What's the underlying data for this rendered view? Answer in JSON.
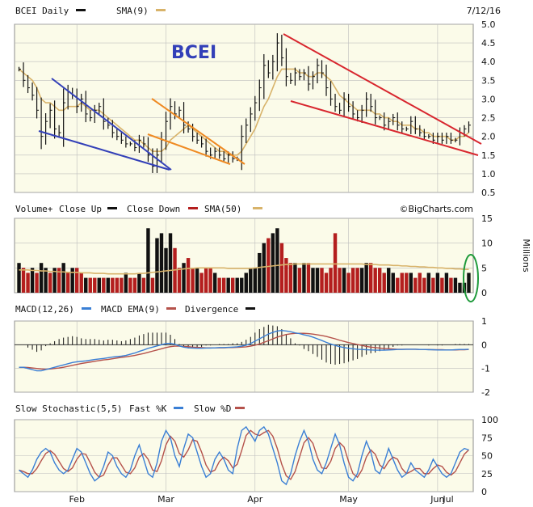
{
  "header": {
    "symbol_label": "BCEI Daily",
    "sma_label": "SMA(9)",
    "date": "7/12/16"
  },
  "annotation_ticker": "BCEI",
  "volume_header": {
    "title": "Volume+",
    "close_up": "Close Up",
    "close_down": "Close Down",
    "sma": "SMA(50)",
    "source": "©BigCharts.com",
    "units": "Millions"
  },
  "macd_header": {
    "title": "MACD(12,26)",
    "ema": "MACD EMA(9)",
    "divergence": "Divergence"
  },
  "stoch_header": {
    "title": "Slow Stochastic(5,5)",
    "fast": "Fast %K",
    "slow": "Slow %D"
  },
  "colors": {
    "panel_bg": "#fbfbe9",
    "grid": "#bdbdbd",
    "up": "#111111",
    "down": "#b41e1e",
    "sma": "#d8b36a",
    "macd": "#3a7fd5",
    "macd_ema": "#b5524b",
    "fast_k": "#3a7fd5",
    "slow_d": "#b5524b",
    "blue_trend": "#3340b8",
    "orange_trend": "#ef8a22",
    "red_trend": "#d8262e",
    "highlight_ellipse": "#1e9a3a"
  },
  "chart_data": [
    {
      "type": "line",
      "name": "price",
      "title": "BCEI Daily",
      "x_ticks": [
        "Feb",
        "Mar",
        "Apr",
        "May",
        "Jun",
        "Jul"
      ],
      "y_ticks": [
        "0.5",
        "1.0",
        "1.5",
        "2.0",
        "2.5",
        "3.0",
        "3.5",
        "4.0",
        "4.5",
        "5.0"
      ],
      "ylim": [
        0.5,
        5.0
      ],
      "close": [
        3.8,
        3.5,
        3.3,
        3.1,
        2.7,
        2.0,
        2.4,
        2.7,
        2.2,
        2.1,
        2.9,
        3.2,
        3.1,
        2.8,
        3.0,
        2.6,
        2.5,
        2.7,
        2.8,
        2.4,
        2.3,
        2.1,
        2.0,
        1.9,
        1.8,
        1.8,
        1.7,
        1.9,
        1.8,
        1.5,
        1.2,
        1.5,
        1.9,
        2.4,
        2.8,
        2.6,
        2.7,
        2.3,
        2.2,
        2.0,
        1.9,
        1.8,
        1.6,
        1.5,
        1.6,
        1.5,
        1.4,
        1.5,
        1.4,
        1.4,
        2.0,
        2.3,
        2.6,
        2.9,
        3.3,
        3.9,
        3.7,
        4.0,
        4.5,
        4.1,
        3.6,
        3.5,
        3.7,
        3.6,
        3.7,
        3.4,
        3.6,
        3.9,
        3.7,
        3.3,
        3.0,
        2.8,
        2.7,
        3.0,
        2.8,
        2.6,
        2.5,
        2.7,
        3.0,
        2.8,
        2.5,
        2.5,
        2.3,
        2.4,
        2.5,
        2.3,
        2.2,
        2.2,
        2.4,
        2.2,
        2.1,
        2.0,
        2.0,
        1.9,
        2.0,
        1.9,
        2.0,
        1.9,
        1.9,
        2.1,
        2.2,
        2.3
      ],
      "sma9": [
        3.8,
        3.7,
        3.6,
        3.5,
        3.3,
        3.0,
        2.9,
        2.9,
        2.8,
        2.7,
        2.7,
        2.8,
        2.8,
        2.8,
        2.9,
        2.8,
        2.7,
        2.7,
        2.7,
        2.6,
        2.5,
        2.4,
        2.3,
        2.2,
        2.1,
        2.0,
        1.9,
        1.9,
        1.8,
        1.7,
        1.6,
        1.6,
        1.6,
        1.7,
        1.9,
        2.0,
        2.1,
        2.2,
        2.3,
        2.2,
        2.1,
        2.0,
        1.9,
        1.8,
        1.7,
        1.6,
        1.6,
        1.5,
        1.5,
        1.5,
        1.6,
        1.8,
        2.0,
        2.2,
        2.5,
        2.8,
        3.0,
        3.3,
        3.6,
        3.8,
        3.8,
        3.8,
        3.8,
        3.7,
        3.7,
        3.6,
        3.6,
        3.7,
        3.7,
        3.6,
        3.5,
        3.3,
        3.1,
        3.0,
        2.9,
        2.8,
        2.7,
        2.7,
        2.7,
        2.7,
        2.6,
        2.6,
        2.5,
        2.5,
        2.4,
        2.4,
        2.3,
        2.3,
        2.3,
        2.2,
        2.2,
        2.1,
        2.1,
        2.0,
        2.0,
        2.0,
        2.0,
        1.9,
        1.9,
        2.0,
        2.0,
        2.1
      ]
    },
    {
      "type": "bar",
      "name": "volume",
      "y_ticks": [
        "0",
        "5",
        "10",
        "15"
      ],
      "ylim": [
        0,
        15
      ],
      "values": [
        6,
        5,
        4,
        5,
        4,
        6,
        5,
        4,
        5,
        5,
        6,
        4,
        5,
        5,
        4,
        3,
        3,
        3,
        3,
        3,
        3,
        3,
        3,
        3,
        4,
        3,
        3,
        4,
        3,
        13,
        3,
        11,
        12,
        9,
        12,
        9,
        5,
        6,
        7,
        5,
        5,
        4,
        5,
        5,
        4,
        3,
        3,
        3,
        3,
        3,
        3,
        4,
        5,
        5,
        8,
        10,
        11,
        12,
        13,
        10,
        7,
        6,
        6,
        5,
        6,
        6,
        5,
        5,
        5,
        4,
        5,
        12,
        5,
        5,
        4,
        5,
        5,
        5,
        6,
        6,
        5,
        5,
        4,
        5,
        4,
        3,
        4,
        4,
        4,
        3,
        4,
        3,
        4,
        3,
        4,
        3,
        4,
        3,
        3,
        2,
        2,
        4
      ],
      "up": [
        1,
        0,
        0,
        1,
        0,
        1,
        1,
        0,
        1,
        0,
        1,
        0,
        1,
        0,
        0,
        1,
        0,
        0,
        1,
        0,
        1,
        0,
        0,
        0,
        1,
        0,
        0,
        1,
        0,
        1,
        0,
        1,
        1,
        1,
        1,
        0,
        0,
        1,
        0,
        0,
        1,
        0,
        0,
        0,
        1,
        0,
        0,
        1,
        0,
        1,
        1,
        1,
        1,
        1,
        1,
        1,
        0,
        1,
        1,
        0,
        0,
        0,
        1,
        0,
        1,
        0,
        1,
        1,
        0,
        0,
        0,
        0,
        0,
        1,
        0,
        0,
        0,
        1,
        1,
        0,
        0,
        0,
        0,
        1,
        1,
        0,
        0,
        0,
        1,
        0,
        0,
        0,
        1,
        0,
        1,
        0,
        1,
        0,
        1,
        1,
        1,
        1
      ],
      "sma50": [
        4.6,
        4.6,
        4.6,
        4.5,
        4.5,
        4.4,
        4.4,
        4.3,
        4.3,
        4.2,
        4.2,
        4.1,
        4.1,
        4.1,
        4.0,
        4.0,
        4.0,
        3.9,
        3.9,
        3.9,
        3.8,
        3.8,
        3.8,
        3.8,
        3.8,
        3.8,
        3.8,
        3.9,
        3.9,
        4.0,
        4.1,
        4.2,
        4.3,
        4.4,
        4.5,
        4.6,
        4.7,
        4.8,
        4.9,
        4.9,
        5.0,
        5.0,
        5.0,
        5.0,
        5.0,
        5.0,
        5.0,
        4.9,
        4.9,
        4.9,
        4.9,
        4.9,
        4.9,
        5.0,
        5.1,
        5.2,
        5.3,
        5.4,
        5.5,
        5.6,
        5.7,
        5.7,
        5.8,
        5.8,
        5.8,
        5.8,
        5.8,
        5.8,
        5.8,
        5.8,
        5.8,
        5.8,
        5.8,
        5.8,
        5.8,
        5.8,
        5.8,
        5.8,
        5.7,
        5.7,
        5.7,
        5.6,
        5.6,
        5.6,
        5.5,
        5.5,
        5.4,
        5.4,
        5.3,
        5.3,
        5.2,
        5.2,
        5.1,
        5.1,
        5.0,
        5.0,
        4.9,
        4.9,
        4.8,
        4.8,
        4.7,
        4.7
      ]
    },
    {
      "type": "line",
      "name": "macd",
      "y_ticks": [
        "1",
        "0",
        "-1",
        "-2"
      ],
      "ylim": [
        -2,
        1
      ],
      "macd": [
        -0.95,
        -0.95,
        -1.0,
        -1.05,
        -1.1,
        -1.1,
        -1.05,
        -1.0,
        -0.95,
        -0.9,
        -0.85,
        -0.8,
        -0.75,
        -0.72,
        -0.7,
        -0.68,
        -0.65,
        -0.62,
        -0.6,
        -0.58,
        -0.55,
        -0.52,
        -0.5,
        -0.48,
        -0.45,
        -0.4,
        -0.35,
        -0.28,
        -0.22,
        -0.15,
        -0.1,
        -0.05,
        0.0,
        0.05,
        0.06,
        0.02,
        -0.05,
        -0.1,
        -0.13,
        -0.14,
        -0.15,
        -0.15,
        -0.14,
        -0.14,
        -0.13,
        -0.12,
        -0.12,
        -0.11,
        -0.1,
        -0.09,
        -0.06,
        -0.02,
        0.05,
        0.15,
        0.25,
        0.35,
        0.45,
        0.52,
        0.58,
        0.6,
        0.58,
        0.55,
        0.5,
        0.47,
        0.42,
        0.38,
        0.32,
        0.25,
        0.18,
        0.1,
        0.03,
        -0.03,
        -0.08,
        -0.12,
        -0.15,
        -0.17,
        -0.19,
        -0.2,
        -0.21,
        -0.22,
        -0.23,
        -0.23,
        -0.23,
        -0.22,
        -0.21,
        -0.2,
        -0.2,
        -0.19,
        -0.19,
        -0.19,
        -0.2,
        -0.2,
        -0.21,
        -0.21,
        -0.22,
        -0.22,
        -0.22,
        -0.22,
        -0.21,
        -0.2,
        -0.2,
        -0.19
      ],
      "ema": [
        -0.95,
        -0.95,
        -0.96,
        -0.98,
        -1.0,
        -1.02,
        -1.03,
        -1.02,
        -1.0,
        -0.98,
        -0.95,
        -0.91,
        -0.87,
        -0.83,
        -0.79,
        -0.76,
        -0.73,
        -0.7,
        -0.67,
        -0.64,
        -0.62,
        -0.59,
        -0.56,
        -0.53,
        -0.51,
        -0.48,
        -0.45,
        -0.41,
        -0.37,
        -0.32,
        -0.27,
        -0.22,
        -0.17,
        -0.12,
        -0.08,
        -0.06,
        -0.06,
        -0.07,
        -0.08,
        -0.1,
        -0.11,
        -0.12,
        -0.13,
        -0.13,
        -0.13,
        -0.13,
        -0.13,
        -0.12,
        -0.12,
        -0.11,
        -0.1,
        -0.09,
        -0.06,
        -0.02,
        0.03,
        0.1,
        0.17,
        0.25,
        0.32,
        0.38,
        0.43,
        0.46,
        0.48,
        0.48,
        0.48,
        0.47,
        0.45,
        0.42,
        0.39,
        0.35,
        0.3,
        0.25,
        0.19,
        0.14,
        0.09,
        0.05,
        0.01,
        -0.03,
        -0.07,
        -0.1,
        -0.12,
        -0.14,
        -0.16,
        -0.17,
        -0.18,
        -0.19,
        -0.19,
        -0.19,
        -0.19,
        -0.19,
        -0.2,
        -0.2,
        -0.2,
        -0.21,
        -0.21,
        -0.21,
        -0.22,
        -0.22,
        -0.22,
        -0.21,
        -0.21,
        -0.2
      ]
    },
    {
      "type": "line",
      "name": "slow_stochastic",
      "y_ticks": [
        "100",
        "75",
        "50",
        "25",
        "0"
      ],
      "ylim": [
        0,
        100
      ],
      "fast_k": [
        30,
        25,
        20,
        30,
        45,
        55,
        60,
        55,
        40,
        30,
        25,
        30,
        45,
        60,
        55,
        40,
        25,
        15,
        20,
        35,
        55,
        50,
        35,
        25,
        20,
        30,
        50,
        65,
        45,
        25,
        20,
        40,
        70,
        85,
        75,
        50,
        35,
        60,
        80,
        75,
        55,
        35,
        20,
        25,
        45,
        55,
        45,
        30,
        25,
        60,
        85,
        90,
        80,
        70,
        85,
        90,
        80,
        60,
        40,
        15,
        10,
        25,
        50,
        70,
        85,
        70,
        45,
        30,
        25,
        40,
        60,
        80,
        65,
        40,
        20,
        15,
        25,
        50,
        70,
        55,
        30,
        25,
        40,
        60,
        45,
        30,
        20,
        25,
        40,
        30,
        25,
        20,
        30,
        45,
        35,
        25,
        20,
        25,
        40,
        55,
        60,
        58
      ],
      "slow_d": [
        30,
        28,
        25,
        25,
        32,
        43,
        53,
        57,
        52,
        42,
        32,
        28,
        33,
        45,
        53,
        52,
        40,
        27,
        20,
        23,
        37,
        47,
        47,
        37,
        27,
        25,
        33,
        48,
        53,
        45,
        30,
        28,
        43,
        65,
        77,
        70,
        53,
        48,
        58,
        72,
        70,
        55,
        37,
        27,
        30,
        42,
        48,
        43,
        33,
        38,
        57,
        78,
        85,
        80,
        78,
        82,
        85,
        77,
        60,
        38,
        22,
        17,
        28,
        48,
        68,
        75,
        67,
        48,
        33,
        32,
        42,
        60,
        68,
        62,
        42,
        25,
        20,
        30,
        48,
        58,
        52,
        37,
        32,
        42,
        48,
        45,
        32,
        25,
        28,
        32,
        32,
        25,
        25,
        32,
        37,
        35,
        27,
        23,
        28,
        40,
        52,
        58
      ]
    }
  ]
}
